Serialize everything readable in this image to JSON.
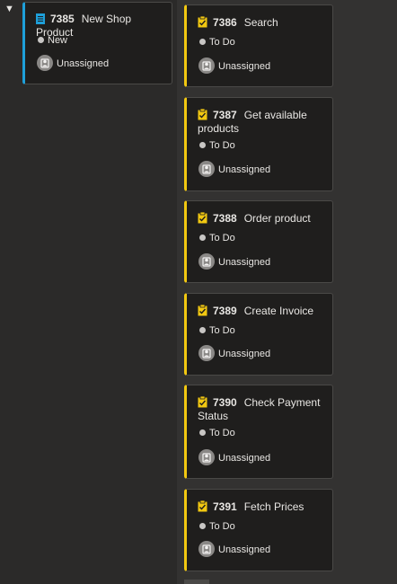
{
  "toggle": "▼",
  "parent": {
    "id": "7385",
    "title": "New Shop Product",
    "state": "New",
    "assignee": "Unassigned",
    "accent": "#1e9fd9"
  },
  "tasks": [
    {
      "id": "7386",
      "title": "Search",
      "state": "To Do",
      "assignee": "Unassigned"
    },
    {
      "id": "7387",
      "title": "Get available products",
      "state": "To Do",
      "assignee": "Unassigned"
    },
    {
      "id": "7388",
      "title": "Order product",
      "state": "To Do",
      "assignee": "Unassigned"
    },
    {
      "id": "7389",
      "title": "Create Invoice",
      "state": "To Do",
      "assignee": "Unassigned"
    },
    {
      "id": "7390",
      "title": "Check Payment Status",
      "state": "To Do",
      "assignee": "Unassigned"
    },
    {
      "id": "7391",
      "title": "Fetch Prices",
      "state": "To Do",
      "assignee": "Unassigned"
    }
  ],
  "colors": {
    "task_accent": "#f2c811",
    "pbi_accent": "#1e9fd9",
    "state_dot": "#c8c6c4"
  },
  "icons": {
    "pbi": "book-icon",
    "task": "clipboard-check-icon",
    "assignee": "user-avatar-icon"
  }
}
